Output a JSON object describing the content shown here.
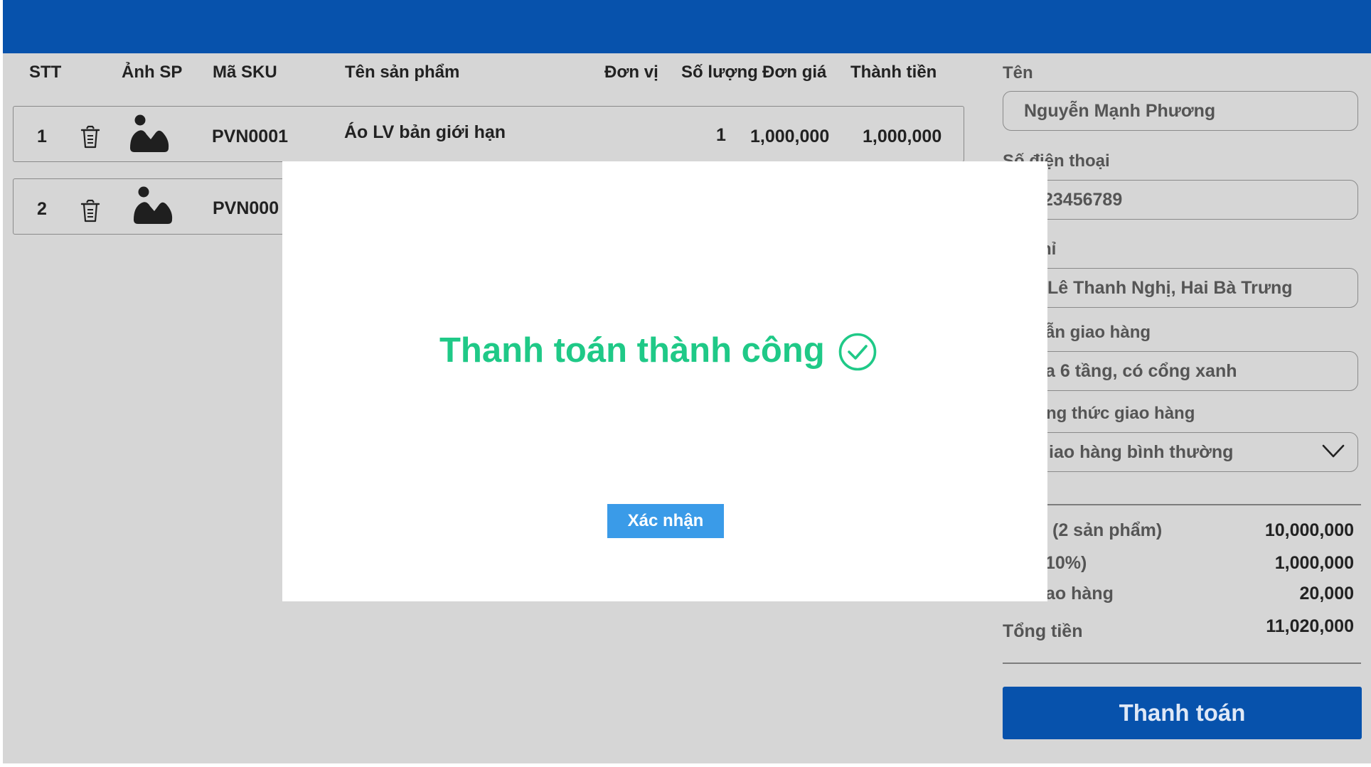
{
  "table": {
    "headers": {
      "stt": "STT",
      "image": "Ảnh SP",
      "sku": "Mã SKU",
      "name": "Tên sản phẩm",
      "unit": "Đơn vị",
      "qty": "Số lượng",
      "price": "Đơn giá",
      "total": "Thành tiền"
    },
    "rows": [
      {
        "stt": "1",
        "sku": "PVN0001",
        "name": "Áo LV bản giới hạn",
        "qty": "1",
        "price": "1,000,000",
        "total": "1,000,000"
      },
      {
        "stt": "2",
        "sku": "PVN000"
      }
    ]
  },
  "customer": {
    "name_label": "Tên",
    "name_value": "Nguyễn Mạnh Phương",
    "phone_label": "Số điện thoại",
    "phone_value": "23456789",
    "address_label": "hỉ",
    "address_value": "Lê Thanh Nghị, Hai Bà Trưng",
    "note_label": "ẫn giao hàng",
    "note_value": "a 6 tầng, có cổng xanh",
    "method_label": "ng thức giao hàng",
    "method_value": "iao hàng bình thường"
  },
  "summary": {
    "subtotal_label": "(2 sản phẩm)",
    "subtotal_value": "10,000,000",
    "tax_label": "10%)",
    "tax_value": "1,000,000",
    "shipping_label": "ao hàng",
    "shipping_value": "20,000",
    "total_label": "Tổng tiền",
    "total_value": "11,020,000"
  },
  "pay_button": "Thanh toán",
  "modal": {
    "message": "Thanh toán thành công",
    "confirm_label": "Xác nhận"
  },
  "colors": {
    "header_bar": "#0752ac",
    "background": "#d6d6d6",
    "success_text": "#1fc987",
    "confirm_button": "#3a9be8"
  },
  "icons": {
    "trash": "trash-icon",
    "image": "image-placeholder-icon",
    "chevron": "chevron-down-icon",
    "success": "check-circle-icon"
  }
}
